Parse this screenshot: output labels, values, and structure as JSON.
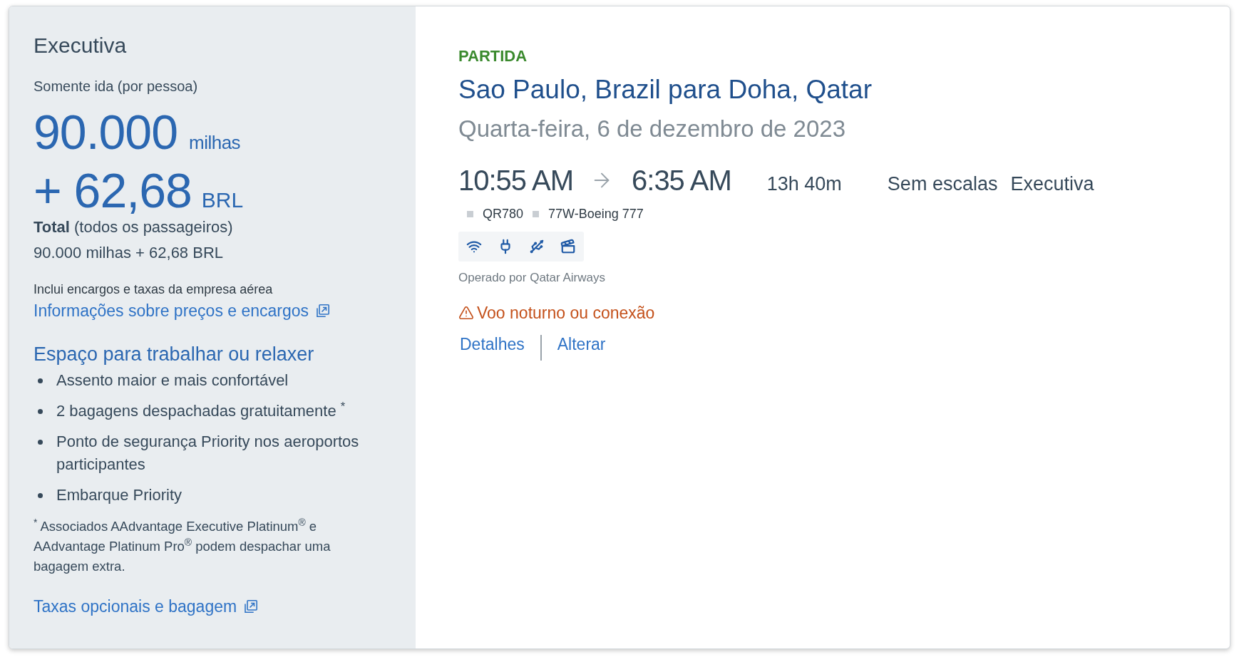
{
  "fare_panel": {
    "cabin": "Executiva",
    "trip_type": "Somente ida (por pessoa)",
    "miles": "90.000",
    "miles_unit": "milhas",
    "cash": "+ 62,68",
    "cash_unit": "BRL",
    "total_label": "**Total** (todos os passageiros)",
    "total_value": "90.000 milhas + 62,68 BRL",
    "fees_note": "Inclui encargos e taxas da empresa aérea",
    "fees_link": "Informações sobre preços e encargos",
    "benefits_title": "Espaço para trabalhar ou relaxer",
    "benefits": [
      "Assento maior e mais confortável",
      "2 bagagens despachadas gratuitamente $^{*}$",
      "Ponto de segurança Priority nos aeroportos participantes",
      "Embarque Priority"
    ],
    "footnote": "$^{*}$ Associados AAdvantage Executive Platinum$^{®}$ e AAdvantage Platinum Pro$^{®}$ podem despachar uma bagagem extra.",
    "bag_link": "Taxas opcionais e bagagem"
  },
  "flight": {
    "direction": "PARTIDA",
    "route": "Sao Paulo, Brazil para Doha, Qatar",
    "date": "Quarta-feira, 6 de dezembro de 2023",
    "departure": "10:55 AM",
    "arrival": "6:35 AM",
    "duration": "13h 40m",
    "stops": "Sem escalas",
    "cabin": "Executiva",
    "flight_number": "QR780",
    "aircraft": "77W-Boeing 777",
    "amenities": [
      {
        "kind": "wifi"
      },
      {
        "kind": "power"
      },
      {
        "kind": "usb"
      },
      {
        "kind": "entertainment"
      }
    ],
    "operator": "Operado por Qatar Airways",
    "warning": "Voo noturno ou conexão",
    "links": [
      "Detalhes",
      "Alterar"
    ]
  }
}
